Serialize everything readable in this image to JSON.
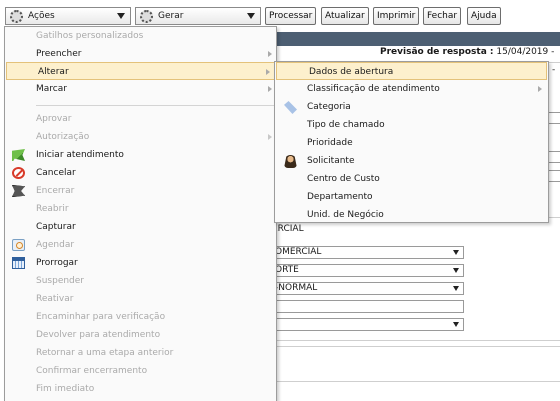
{
  "toolbar": {
    "acoes_label": "Ações",
    "gerar_label": "Gerar",
    "buttons": [
      "Processar",
      "Atualizar",
      "Imprimir",
      "Fechar",
      "Ajuda"
    ]
  },
  "form": {
    "forecast_label": "Previsão de resposta :",
    "forecast_value": "15/04/2019 -",
    "right_dash": "-",
    "area_text": "ERCIAL",
    "selects": [
      "OMERCIAL",
      "ORTE",
      "-NORMAL",
      "",
      ""
    ]
  },
  "menu": {
    "items": [
      {
        "label": "Gatilhos personalizados",
        "disabled": true
      },
      {
        "label": "Preencher",
        "submenu": true
      },
      {
        "label": "Alterar",
        "submenu": true,
        "active": true
      },
      {
        "label": "Marcar",
        "submenu": true
      },
      {
        "label": "Aprovar",
        "disabled": true
      },
      {
        "label": "Autorização",
        "disabled": true,
        "submenu": true
      },
      {
        "label": "Iniciar atendimento",
        "icon": "green-flag-icon"
      },
      {
        "label": "Cancelar",
        "icon": "cancel-icon"
      },
      {
        "label": "Encerrar",
        "disabled": true,
        "icon": "finish-flag-icon"
      },
      {
        "label": "Reabrir",
        "disabled": true
      },
      {
        "label": "Capturar"
      },
      {
        "label": "Agendar",
        "disabled": true,
        "icon": "schedule-icon"
      },
      {
        "label": "Prorrogar",
        "icon": "calendar-icon"
      },
      {
        "label": "Suspender",
        "disabled": true
      },
      {
        "label": "Reativar",
        "disabled": true
      },
      {
        "label": "Encaminhar para verificação",
        "disabled": true
      },
      {
        "label": "Devolver para atendimento",
        "disabled": true
      },
      {
        "label": "Retornar a uma etapa anterior",
        "disabled": true
      },
      {
        "label": "Confirmar encerramento",
        "disabled": true
      },
      {
        "label": "Fim imediato",
        "disabled": true
      }
    ]
  },
  "submenu": {
    "items": [
      {
        "label": "Dados de abertura",
        "active": true
      },
      {
        "label": "Classificação de atendimento",
        "submenu": true
      },
      {
        "label": "Categoria",
        "icon": "tag-icon"
      },
      {
        "label": "Tipo de chamado"
      },
      {
        "label": "Prioridade"
      },
      {
        "label": "Solicitante",
        "icon": "user-icon"
      },
      {
        "label": "Centro de Custo"
      },
      {
        "label": "Departamento"
      },
      {
        "label": "Unid. de Negócio"
      }
    ]
  },
  "colors": {
    "header_bar": "#4d5f73",
    "active_item_bg": "#fdf0cd",
    "active_item_border": "#e4c27a",
    "disabled_text": "#aaaaaa"
  }
}
